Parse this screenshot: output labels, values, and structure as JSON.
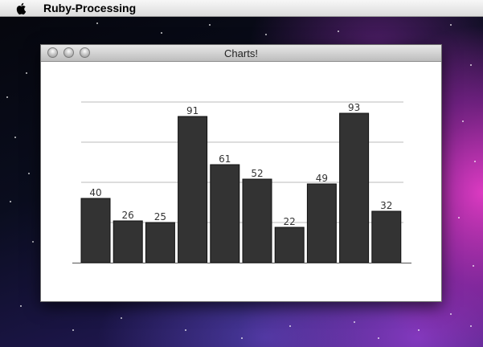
{
  "menubar": {
    "app_name": "Ruby-Processing",
    "apple_icon": "apple-icon"
  },
  "window": {
    "title": "Charts!",
    "buttons": [
      "close-button",
      "minimize-button",
      "zoom-button"
    ]
  },
  "chart_data": {
    "type": "bar",
    "values": [
      40,
      26,
      25,
      91,
      61,
      52,
      22,
      49,
      93,
      32
    ],
    "ylim": [
      0,
      100
    ],
    "grid": true,
    "gridlines": [
      25,
      50,
      75,
      100
    ],
    "bar_color": "#333333",
    "gridline_color": "#bbbbbb"
  }
}
